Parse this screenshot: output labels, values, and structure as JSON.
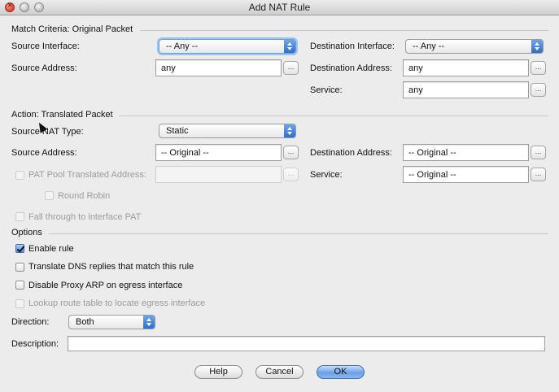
{
  "window": {
    "title": "Add NAT Rule"
  },
  "match_criteria": {
    "heading": "Match Criteria: Original Packet",
    "source_interface": {
      "label": "Source Interface:",
      "value": "-- Any --"
    },
    "destination_interface": {
      "label": "Destination Interface:",
      "value": "-- Any --"
    },
    "source_address": {
      "label": "Source Address:",
      "value": "any"
    },
    "destination_address": {
      "label": "Destination Address:",
      "value": "any"
    },
    "service": {
      "label": "Service:",
      "value": "any"
    }
  },
  "action": {
    "heading": "Action: Translated Packet",
    "source_nat_type": {
      "label": "Source NAT Type:",
      "value": "Static"
    },
    "source_address": {
      "label": "Source Address:",
      "value": "-- Original --"
    },
    "destination_address": {
      "label": "Destination Address:",
      "value": "-- Original --"
    },
    "pat_pool": {
      "label": "PAT Pool Translated Address:",
      "value": ""
    },
    "service": {
      "label": "Service:",
      "value": "-- Original --"
    },
    "round_robin": {
      "label": "Round Robin"
    },
    "fall_through": {
      "label": "Fall through to interface PAT"
    }
  },
  "options": {
    "heading": "Options",
    "enable_rule": {
      "label": "Enable rule",
      "checked": true
    },
    "translate_dns": {
      "label": "Translate DNS replies that match this rule",
      "checked": false
    },
    "disable_proxy_arp": {
      "label": "Disable Proxy ARP on egress interface",
      "checked": false
    },
    "lookup_route": {
      "label": "Lookup route table to locate egress interface",
      "checked": false
    },
    "direction": {
      "label": "Direction:",
      "value": "Both"
    },
    "description": {
      "label": "Description:",
      "value": ""
    }
  },
  "ellipsis_label": "...",
  "buttons": {
    "help": "Help",
    "cancel": "Cancel",
    "ok": "OK"
  }
}
